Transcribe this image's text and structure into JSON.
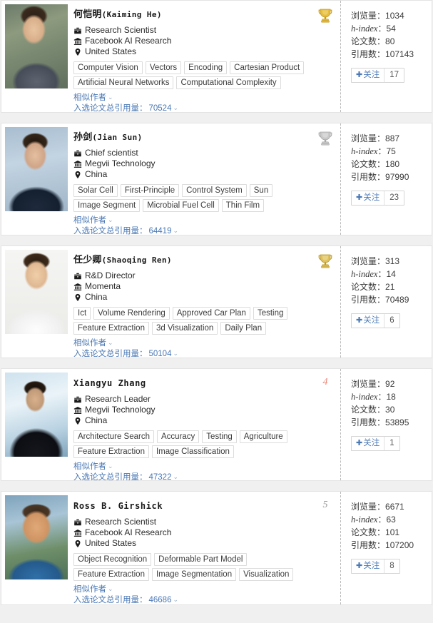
{
  "page": {
    "title": "Scholar Ranking List",
    "labels": {
      "similar_authors": "相似作者",
      "selected_citations": "入选论文总引用量",
      "views": "浏览量",
      "h_index": "h-index",
      "papers": "论文数",
      "citations": "引用数",
      "follow": "关注",
      "plus": "✚",
      "colon": "：",
      "caret": "⌄"
    },
    "colors": {
      "link": "#4a78b5",
      "rank_highlight": "#e98b7c",
      "rank_plain": "#9a9a9a",
      "tag_border": "#dcdcdc",
      "card_border": "#e3e3e3",
      "divider": "#b9b9b9",
      "trophy_gold": "#e2b93b",
      "trophy_silver": "#b9b9b9"
    }
  },
  "scholars": [
    {
      "rank": 1,
      "rank_type": "trophy-gold",
      "rank_display": "",
      "avatar_class": "av-kaiming",
      "avatar_name": "avatar-kaiming-he",
      "name_cn": "何恺明",
      "name_en": "(Kaiming He)",
      "name_is_latin_only": false,
      "position": "Research Scientist",
      "affiliation": "Facebook AI Research",
      "country": "United States",
      "tags_row1": [
        "Computer Vision",
        "Vectors",
        "Encoding",
        "Cartesian Product"
      ],
      "tags_row2": [
        "Artificial Neural Networks",
        "Computational Complexity"
      ],
      "similar_authors": "相似作者",
      "citation_label": "入选论文总引用量",
      "citation_value": "70524",
      "stats": {
        "views_label": "浏览量",
        "views": "1034",
        "h_index_label": "h-index",
        "h_index": "54",
        "papers_label": "论文数",
        "papers": "80",
        "citations_label": "引用数",
        "citations": "107143"
      },
      "follow_label": "关注",
      "follow_count": "17"
    },
    {
      "rank": 2,
      "rank_type": "trophy-silver",
      "rank_display": "",
      "avatar_class": "av-jian",
      "avatar_name": "avatar-jian-sun",
      "name_cn": "孙剑",
      "name_en": "(Jian Sun)",
      "name_is_latin_only": false,
      "position": "Chief scientist",
      "affiliation": "Megvii Technology",
      "country": "China",
      "tags_row1": [
        "Solar Cell",
        "First-Principle",
        "Control System",
        "Sun"
      ],
      "tags_row2": [
        "Image Segment",
        "Microbial Fuel Cell",
        "Thin Film"
      ],
      "similar_authors": "相似作者",
      "citation_label": "入选论文总引用量",
      "citation_value": "64419",
      "stats": {
        "views_label": "浏览量",
        "views": "887",
        "h_index_label": "h-index",
        "h_index": "75",
        "papers_label": "论文数",
        "papers": "180",
        "citations_label": "引用数",
        "citations": "97990"
      },
      "follow_label": "关注",
      "follow_count": "23"
    },
    {
      "rank": 3,
      "rank_type": "trophy-bronze",
      "rank_display": "",
      "avatar_class": "av-shaoqing",
      "avatar_name": "avatar-shaoqing-ren",
      "name_cn": "任少卿",
      "name_en": "(Shaoqing Ren)",
      "name_is_latin_only": false,
      "position": "R&D Director",
      "affiliation": "Momenta",
      "country": "China",
      "tags_row1": [
        "Ict",
        "Volume Rendering",
        "Approved Car Plan",
        "Testing"
      ],
      "tags_row2": [
        "Feature Extraction",
        "3d Visualization",
        "Daily Plan"
      ],
      "similar_authors": "相似作者",
      "citation_label": "入选论文总引用量",
      "citation_value": "50104",
      "stats": {
        "views_label": "浏览量",
        "views": "313",
        "h_index_label": "h-index",
        "h_index": "14",
        "papers_label": "论文数",
        "papers": "21",
        "citations_label": "引用数",
        "citations": "70489"
      },
      "follow_label": "关注",
      "follow_count": "6"
    },
    {
      "rank": 4,
      "rank_type": "number-highlight",
      "rank_display": "4",
      "avatar_class": "av-xiangyu",
      "avatar_name": "avatar-xiangyu-zhang",
      "name_cn": "",
      "name_en": "Xiangyu Zhang",
      "name_is_latin_only": true,
      "position": "Research Leader",
      "affiliation": "Megvii Technology",
      "country": "China",
      "tags_row1": [
        "Architecture Search",
        "Accuracy",
        "Testing",
        "Agriculture"
      ],
      "tags_row2": [
        "Feature Extraction",
        "Image Classification"
      ],
      "similar_authors": "相似作者",
      "citation_label": "入选论文总引用量",
      "citation_value": "47322",
      "stats": {
        "views_label": "浏览量",
        "views": "92",
        "h_index_label": "h-index",
        "h_index": "18",
        "papers_label": "论文数",
        "papers": "30",
        "citations_label": "引用数",
        "citations": "53895"
      },
      "follow_label": "关注",
      "follow_count": "1"
    },
    {
      "rank": 5,
      "rank_type": "number-plain",
      "rank_display": "5",
      "avatar_class": "av-ross",
      "avatar_name": "avatar-ross-girshick",
      "name_cn": "",
      "name_en": "Ross B. Girshick",
      "name_is_latin_only": true,
      "position": "Research Scientist",
      "affiliation": "Facebook AI Research",
      "country": "United States",
      "tags_row1": [
        "Object Recognition",
        "Deformable Part Model"
      ],
      "tags_row2": [
        "Feature Extraction",
        "Image Segmentation",
        "Visualization"
      ],
      "similar_authors": "相似作者",
      "citation_label": "入选论文总引用量",
      "citation_value": "46686",
      "stats": {
        "views_label": "浏览量",
        "views": "6671",
        "h_index_label": "h-index",
        "h_index": "63",
        "papers_label": "论文数",
        "papers": "101",
        "citations_label": "引用数",
        "citations": "107200"
      },
      "follow_label": "关注",
      "follow_count": "8"
    }
  ]
}
